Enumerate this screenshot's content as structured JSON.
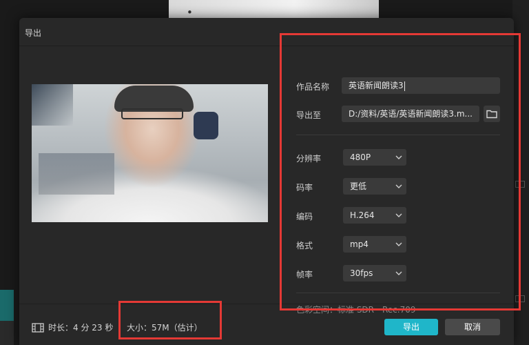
{
  "dialog": {
    "title": "导出"
  },
  "form": {
    "name_label": "作品名称",
    "name_value": "英语新闻朗读3",
    "path_label": "导出至",
    "path_value": "D:/资料/英语/英语新闻朗读3.m..."
  },
  "settings": [
    {
      "label": "分辨率",
      "value": "480P"
    },
    {
      "label": "码率",
      "value": "更低"
    },
    {
      "label": "编码",
      "value": "H.264"
    },
    {
      "label": "格式",
      "value": "mp4"
    },
    {
      "label": "帧率",
      "value": "30fps"
    }
  ],
  "colorspace": "色彩空间：标准 SDR - Rec.709",
  "footer": {
    "duration": "时长：4 分 23 秒",
    "size": "大小：57M（估计）",
    "export_label": "导出",
    "cancel_label": "取消"
  },
  "icons": {
    "folder": "folder-icon",
    "film": "film-icon",
    "chevron": "chevron-down-icon"
  },
  "colors": {
    "accent": "#1fb6c9",
    "highlight": "#e53935"
  }
}
